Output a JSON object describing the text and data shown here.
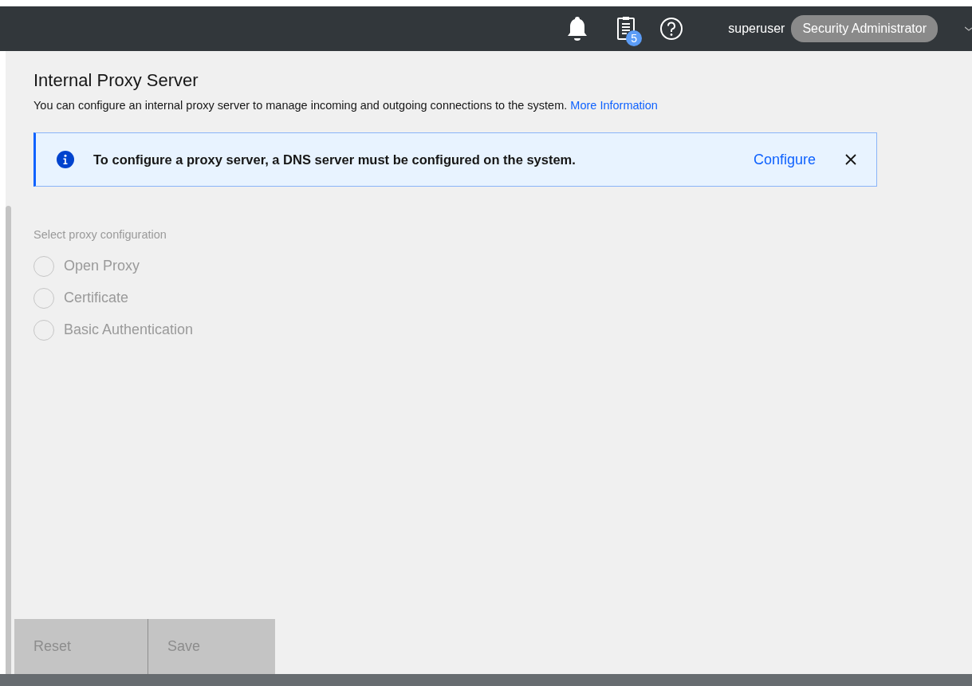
{
  "header": {
    "notification_count": "5",
    "username": "superuser",
    "role": "Security Administrator"
  },
  "page": {
    "title": "Internal Proxy Server",
    "description": "You can configure an internal proxy server to manage incoming and outgoing connections to the system.",
    "link": "More Information"
  },
  "notification": {
    "message": "To configure a proxy server, a DNS server must be configured on the system.",
    "action": "Configure"
  },
  "proxy_configuration": {
    "label": "Select proxy configuration",
    "disabled": true,
    "options": [
      {
        "label": "Open Proxy",
        "selected": false
      },
      {
        "label": "Certificate",
        "selected": false
      },
      {
        "label": "Basic Authentication",
        "selected": false
      }
    ]
  },
  "buttons": [
    {
      "label": "Reset",
      "disabled": true
    },
    {
      "label": "Save",
      "disabled": true
    }
  ]
}
